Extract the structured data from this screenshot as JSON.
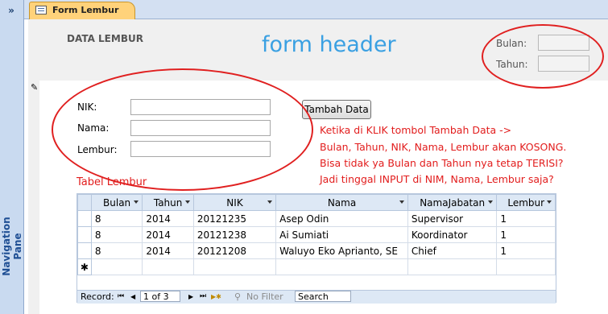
{
  "nav_pane": {
    "toggle": "»",
    "title": "Navigation Pane"
  },
  "tab": {
    "label": "Form Lembur"
  },
  "form_header": {
    "section_title": "DATA LEMBUR",
    "big_label": "form header",
    "bulan_label": "Bulan:",
    "tahun_label": "Tahun:"
  },
  "fields": {
    "nik_label": "NIK:",
    "nama_label": "Nama:",
    "lembur_label": "Lembur:"
  },
  "button": {
    "tambah_label": "Tambah Data"
  },
  "notes": [
    "Ketika di KLIK tombol Tambah Data ->",
    "Bulan, Tahun, NIK, Nama, Lembur akan KOSONG.",
    "Bisa tidak ya Bulan dan Tahun nya tetap TERISI?",
    "Jadi tinggal INPUT di NIM, Nama, Lembur saja?"
  ],
  "tabel_label": "Tabel Lembur",
  "table": {
    "columns": [
      "Bulan",
      "Tahun",
      "NIK",
      "Nama",
      "NamaJabatan",
      "Lembur"
    ],
    "rows": [
      [
        "8",
        "2014",
        "20121235",
        "Asep Odin",
        "Supervisor",
        "1"
      ],
      [
        "8",
        "2014",
        "20121238",
        "Ai Sumiati",
        "Koordinator",
        "1"
      ],
      [
        "8",
        "2014",
        "20121208",
        "Waluyo Eko Aprianto, SE",
        "Chief",
        "1"
      ]
    ],
    "new_row_marker": "✱"
  },
  "record_nav": {
    "label": "Record:",
    "first": "⏮",
    "prev": "◀",
    "position": "1 of 3",
    "next": "▶",
    "last": "⏭",
    "new": "▶✱",
    "filter": "No Filter",
    "search": "Search"
  },
  "colors": {
    "annotation_red": "#e02020",
    "header_blue": "#3aa0e2",
    "tab_orange": "#ffd27a"
  }
}
